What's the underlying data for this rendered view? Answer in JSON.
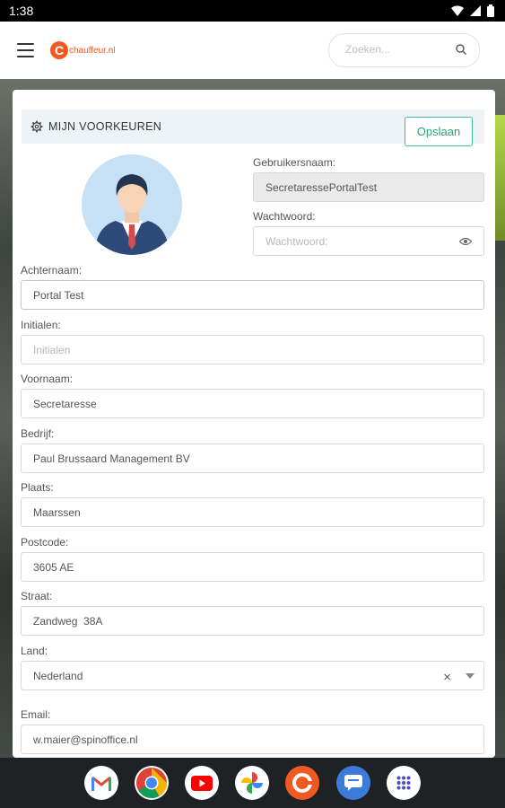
{
  "status_bar": {
    "time": "1:38"
  },
  "header": {
    "logo_text": "chauffeur.nl",
    "search_placeholder": "Zoeken..."
  },
  "card": {
    "title": "MIJN VOORKEUREN",
    "save_label": "Opslaan",
    "fields": {
      "username": {
        "label": "Gebruikersnaam:",
        "value": "SecretaressePortalTest"
      },
      "password": {
        "label": "Wachtwoord:",
        "placeholder": "Wachtwoord:"
      },
      "lastname": {
        "label": "Achternaam:",
        "value": "Portal Test"
      },
      "initials": {
        "label": "Initialen:",
        "placeholder": "Initialen"
      },
      "firstname": {
        "label": "Voornaam:",
        "value": "Secretaresse"
      },
      "company": {
        "label": "Bedrijf:",
        "value": "Paul Brussaard Management BV"
      },
      "city": {
        "label": "Plaats:",
        "value": "Maarssen"
      },
      "postcode": {
        "label": "Postcode:",
        "value": "3605 AE"
      },
      "street": {
        "label": "Straat:",
        "value": "Zandweg  38A"
      },
      "country": {
        "label": "Land:",
        "value": "Nederland"
      },
      "email": {
        "label": "Email:",
        "value": "w.maier@spinoffice.nl"
      }
    }
  },
  "dock": [
    "gmail-icon",
    "chrome-icon",
    "youtube-icon",
    "photos-icon",
    "chauffeur-app-icon",
    "messages-icon",
    "app-drawer-icon"
  ],
  "colors": {
    "brand": "#f05a22",
    "accent": "#3dbe9a",
    "header_bg": "#edf3f6"
  }
}
